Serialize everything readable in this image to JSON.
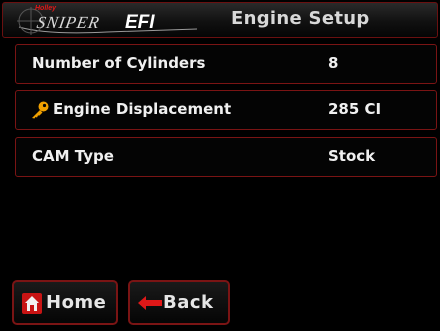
{
  "header": {
    "logo_brand_small": "Holley",
    "logo_text_main": "SNIPER",
    "logo_text_suffix": "EFI",
    "title": "Engine Setup"
  },
  "settings": [
    {
      "label": "Number of Cylinders",
      "value": "8",
      "icon": null
    },
    {
      "label": "Engine Displacement",
      "value": "285 CI",
      "icon": "key-icon"
    },
    {
      "label": "CAM Type",
      "value": "Stock",
      "icon": null
    }
  ],
  "footer": {
    "home_label": "Home",
    "back_label": "Back",
    "home_icon": "home-icon",
    "back_icon": "arrow-left-icon"
  },
  "colors": {
    "background": "#000000",
    "border_accent": "#7a1414",
    "brand_red": "#e01818",
    "key_icon": "#f0a000",
    "text": "#f0f0f0"
  }
}
